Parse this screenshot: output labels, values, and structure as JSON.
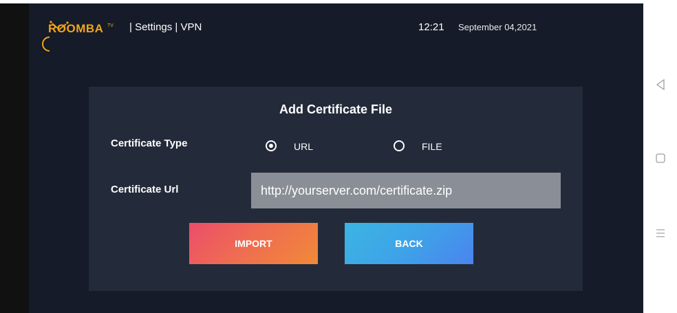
{
  "app": {
    "logo_text": "ROOMBA",
    "logo_superscript": "TV",
    "breadcrumb": "|  Settings  |  VPN",
    "time": "12:21",
    "date": "September 04,2021"
  },
  "dialog": {
    "title": "Add Certificate File",
    "certificate_type_label": "Certificate Type",
    "options": [
      {
        "label": "URL",
        "selected": true
      },
      {
        "label": "FILE",
        "selected": false
      }
    ],
    "certificate_url_label": "Certificate Url",
    "certificate_url_value": "http://yourserver.com/certificate.zip",
    "import_label": "IMPORT",
    "back_label": "BACK"
  },
  "colors": {
    "background": "#151b28",
    "panel": "#232b3a",
    "logo": "#f2a41c",
    "input": "#8a8e96"
  },
  "system_nav": {
    "icons": [
      "back-triangle-icon",
      "home-square-icon",
      "menu-lines-icon"
    ]
  }
}
